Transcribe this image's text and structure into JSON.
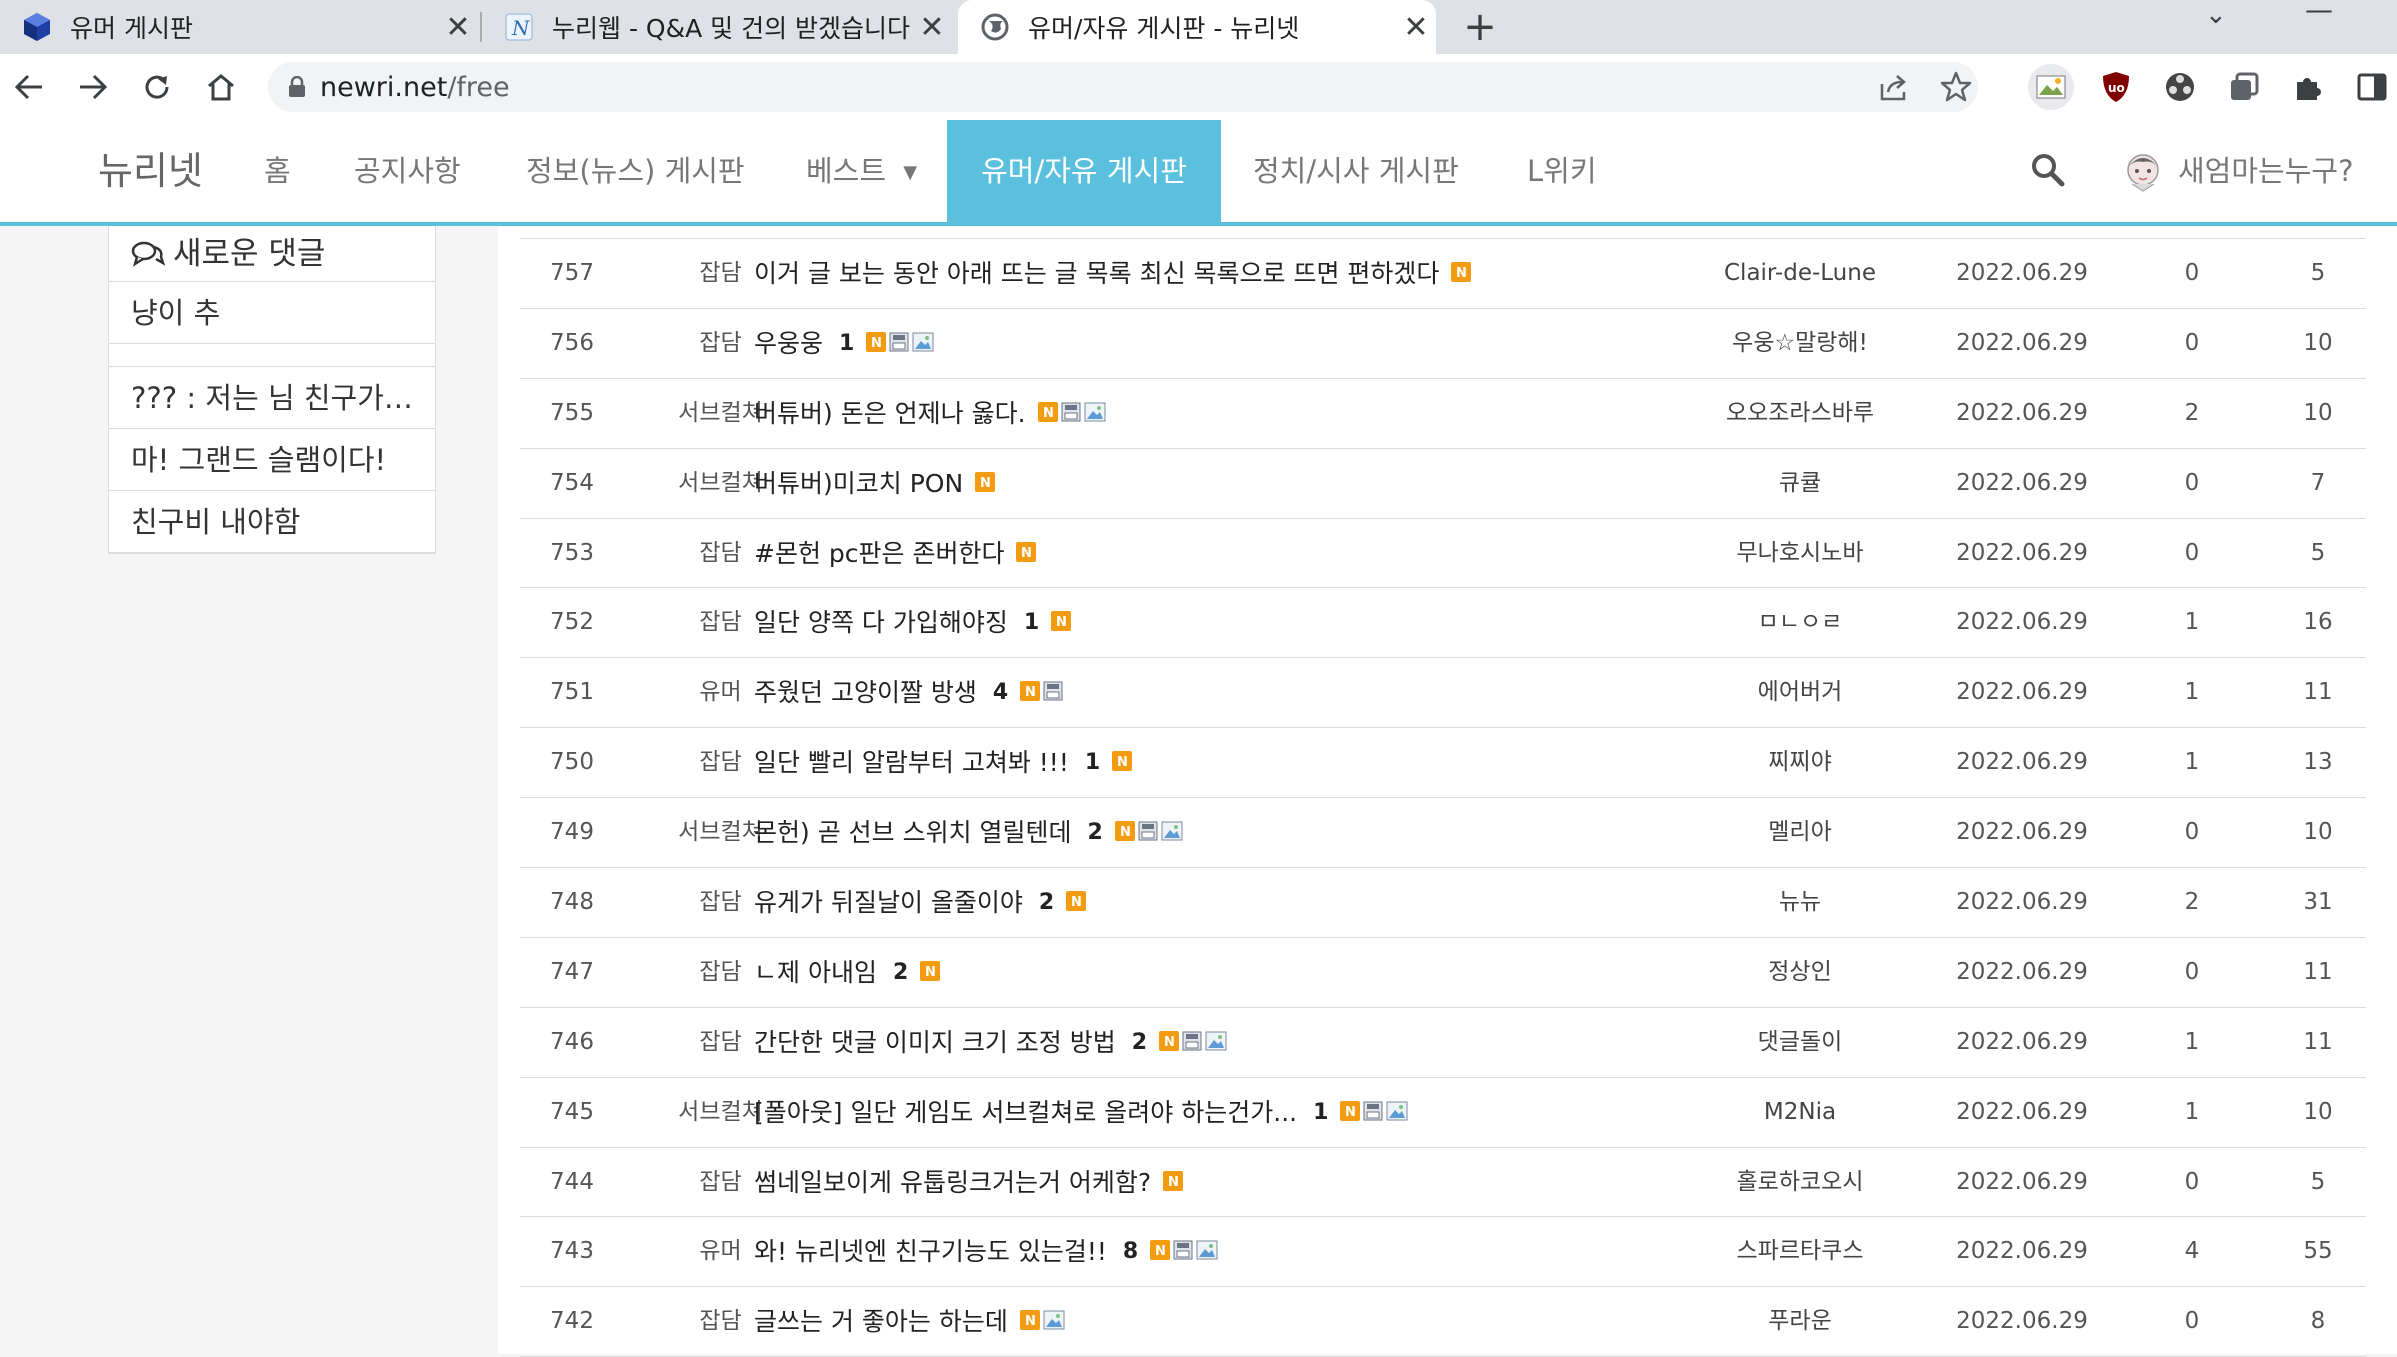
{
  "browser": {
    "tabs": [
      {
        "title": "유머 게시판",
        "active": false
      },
      {
        "title": "누리웹 - Q&A 및 건의 받겠습니다",
        "active": false
      },
      {
        "title": "유머/자유 게시판 - 뉴리넷",
        "active": true
      }
    ],
    "url_host": "newri.net",
    "url_path": "/free"
  },
  "site": {
    "logo": "뉴리넷",
    "menu": [
      "홈",
      "공지사항",
      "정보(뉴스) 게시판",
      "베스트",
      "유머/자유 게시판",
      "정치/시사 게시판",
      "L위키"
    ],
    "active_menu": "유머/자유 게시판",
    "username": "새엄마는누구?"
  },
  "sidebar": {
    "heading": "새로운 댓글",
    "items": [
      "냥이 추",
      "",
      "??? : 저는 님 친구가 아닌데요",
      "마! 그랜드 슬램이다!",
      "친구비 내야함"
    ]
  },
  "posts": [
    {
      "no": "757",
      "category": "잡담",
      "title": "이거 글 보는 동안 아래 뜨는 글 목록 최신 목록으로 뜨면 편하겠다",
      "comments": "",
      "badges": [
        "new"
      ],
      "author": "Clair-de-Lune",
      "date": "2022.06.29",
      "votes": "0",
      "views": "5"
    },
    {
      "no": "756",
      "category": "잡담",
      "title": "우웅웅",
      "comments": "1",
      "badges": [
        "new",
        "file",
        "image"
      ],
      "author": "우웅☆말랑해!",
      "date": "2022.06.29",
      "votes": "0",
      "views": "10"
    },
    {
      "no": "755",
      "category": "서브컬쳐",
      "title": "버튜버) 돈은 언제나 옳다.",
      "comments": "",
      "badges": [
        "new",
        "file",
        "image"
      ],
      "author": "오오조라스바루",
      "date": "2022.06.29",
      "votes": "2",
      "views": "10"
    },
    {
      "no": "754",
      "category": "서브컬쳐",
      "title": "버튜버)미코치 PON",
      "comments": "",
      "badges": [
        "new"
      ],
      "author": "큐큘",
      "date": "2022.06.29",
      "votes": "0",
      "views": "7"
    },
    {
      "no": "753",
      "category": "잡담",
      "title": "#몬헌 pc판은 존버한다",
      "comments": "",
      "badges": [
        "new"
      ],
      "author": "무나호시노바",
      "date": "2022.06.29",
      "votes": "0",
      "views": "5"
    },
    {
      "no": "752",
      "category": "잡담",
      "title": "일단 양쪽 다 가입해야징",
      "comments": "1",
      "badges": [
        "new"
      ],
      "author": "ㅁㄴㅇㄹ",
      "date": "2022.06.29",
      "votes": "1",
      "views": "16"
    },
    {
      "no": "751",
      "category": "유머",
      "title": "주웠던 고양이짤 방생",
      "comments": "4",
      "badges": [
        "new",
        "file"
      ],
      "author": "에어버거",
      "date": "2022.06.29",
      "votes": "1",
      "views": "11"
    },
    {
      "no": "750",
      "category": "잡담",
      "title": "일단 빨리 알람부터 고쳐봐 !!!",
      "comments": "1",
      "badges": [
        "new"
      ],
      "author": "찌찌야",
      "date": "2022.06.29",
      "votes": "1",
      "views": "13"
    },
    {
      "no": "749",
      "category": "서브컬쳐",
      "title": "몬헌) 곧 선브 스위치 열릴텐데",
      "comments": "2",
      "badges": [
        "new",
        "file",
        "image"
      ],
      "author": "멜리아",
      "date": "2022.06.29",
      "votes": "0",
      "views": "10"
    },
    {
      "no": "748",
      "category": "잡담",
      "title": "유게가 뒤질날이 올줄이야",
      "comments": "2",
      "badges": [
        "new"
      ],
      "author": "뉴뉴",
      "date": "2022.06.29",
      "votes": "2",
      "views": "31"
    },
    {
      "no": "747",
      "category": "잡담",
      "title": "ㄴ제 아내임",
      "comments": "2",
      "badges": [
        "new"
      ],
      "author": "정상인",
      "date": "2022.06.29",
      "votes": "0",
      "views": "11"
    },
    {
      "no": "746",
      "category": "잡담",
      "title": "간단한 댓글 이미지 크기 조정 방법",
      "comments": "2",
      "badges": [
        "new",
        "file",
        "image"
      ],
      "author": "댓글돌이",
      "date": "2022.06.29",
      "votes": "1",
      "views": "11"
    },
    {
      "no": "745",
      "category": "서브컬쳐",
      "title": "[폴아웃] 일단 게임도 서브컬쳐로 올려야 하는건가...",
      "comments": "1",
      "badges": [
        "new",
        "file",
        "image"
      ],
      "author": "M2Nia",
      "date": "2022.06.29",
      "votes": "1",
      "views": "10"
    },
    {
      "no": "744",
      "category": "잡담",
      "title": "썸네일보이게 유툽링크거는거 어케함?",
      "comments": "",
      "badges": [
        "new"
      ],
      "author": "홀로하코오시",
      "date": "2022.06.29",
      "votes": "0",
      "views": "5"
    },
    {
      "no": "743",
      "category": "유머",
      "title": "와! 뉴리넷엔 친구기능도 있는걸!!",
      "comments": "8",
      "badges": [
        "new",
        "file",
        "image"
      ],
      "author": "스파르타쿠스",
      "date": "2022.06.29",
      "votes": "4",
      "views": "55"
    },
    {
      "no": "742",
      "category": "잡담",
      "title": "글쓰는 거 좋아는 하는데",
      "comments": "",
      "badges": [
        "new",
        "image"
      ],
      "author": "푸라운",
      "date": "2022.06.29",
      "votes": "0",
      "views": "8"
    }
  ],
  "colors": {
    "accent": "#5bc0de",
    "new_badge": "#f39c12",
    "text": "#222222"
  },
  "icons": {
    "new": "new-badge-icon",
    "file": "file-icon",
    "image": "image-icon"
  }
}
